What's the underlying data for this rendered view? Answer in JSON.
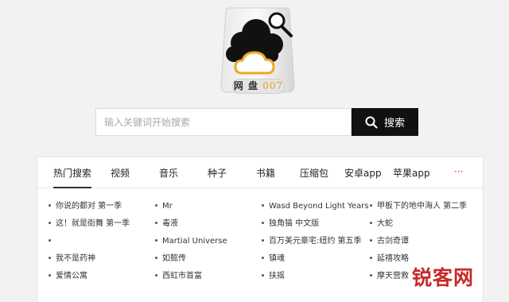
{
  "logo": {
    "label_text": "网 盘",
    "label_num": "007",
    "icon": "cloud-drive-logo"
  },
  "search": {
    "placeholder": "输入关键词开始搜索",
    "button_label": "搜索",
    "button_icon": "search-icon"
  },
  "tabs": [
    {
      "label": "热门搜索",
      "active": true
    },
    {
      "label": "视频"
    },
    {
      "label": "音乐"
    },
    {
      "label": "种子"
    },
    {
      "label": "书籍"
    },
    {
      "label": "压缩包"
    },
    {
      "label": "安卓app"
    },
    {
      "label": "苹果app"
    },
    {
      "label": "···"
    }
  ],
  "hot_items": [
    [
      "你说的都对 第一季",
      "这！就是街舞 第一季",
      "",
      "我不是药神",
      "爱情公寓"
    ],
    [
      "Mr",
      "毒液",
      "Martial Universe",
      "如懿传",
      "西虹市首富"
    ],
    [
      "Wasd Beyond Light Years",
      "独角猫 中文版",
      "百万美元豪宅:纽约 第五季",
      "镇魂",
      "扶摇"
    ],
    [
      "甲板下的地中海人 第二季",
      "大蛇",
      "古剑奇谭",
      "延禧攻略",
      "摩天营救"
    ]
  ],
  "watermark": "锐客网",
  "colors": {
    "background": "#f2f2f2",
    "search_button": "#111111",
    "logo_orange": "#f0a820",
    "watermark": "#c62a2a"
  }
}
